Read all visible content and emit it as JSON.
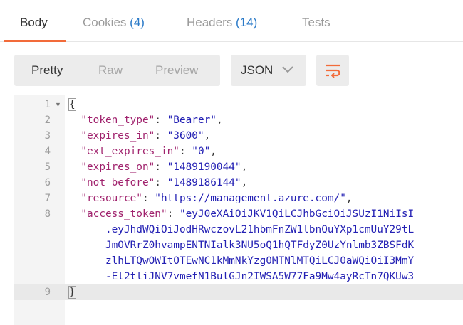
{
  "tabs": {
    "body": "Body",
    "cookies_label": "Cookies",
    "cookies_count": "(4)",
    "headers_label": "Headers",
    "headers_count": "(14)",
    "tests": "Tests"
  },
  "view_modes": {
    "pretty": "Pretty",
    "raw": "Raw",
    "preview": "Preview",
    "selected": "Pretty"
  },
  "format_select": {
    "value": "JSON"
  },
  "wrap_button": {
    "icon": "wrap-lines-icon",
    "color": "#f26b3a"
  },
  "colors": {
    "accent": "#f26b3a",
    "count_blue": "#2a7ac8",
    "json_key": "#a0226d",
    "json_string": "#2421b4"
  },
  "code": {
    "line_numbers": [
      "1",
      "2",
      "3",
      "4",
      "5",
      "6",
      "7",
      "8",
      "9"
    ],
    "open_brace": "{",
    "close_brace": "}",
    "pairs": [
      {
        "key": "\"token_type\"",
        "value": "\"Bearer\""
      },
      {
        "key": "\"expires_in\"",
        "value": "\"3600\""
      },
      {
        "key": "\"ext_expires_in\"",
        "value": "\"0\""
      },
      {
        "key": "\"expires_on\"",
        "value": "\"1489190044\""
      },
      {
        "key": "\"not_before\"",
        "value": "\"1489186144\""
      },
      {
        "key": "\"resource\"",
        "value": "\"https://management.azure.com/\""
      }
    ],
    "access_token_key": "\"access_token\"",
    "access_token_lines": [
      "\"eyJ0eXAiOiJKV1QiLCJhbGciOiJSUzI1NiIsI",
      ".eyJhdWQiOiJodHRwczovL21hbmFnZW1lbnQuYXp1cmUuY29tL",
      "JmOVRrZ0hvampENTNIalk3NU5oQ1hQTFdyZ0UzYnlmb3ZBSFdK",
      "zlhLTQwOWItOTEwNC1kMmNkYzg0MTNlMTQiLCJ0aWQiOiI3MmY",
      "-El2tliJNV7vmefN1BulGJn2IWSA5W77Fa9Mw4ayRcTn7QKUw3"
    ]
  }
}
